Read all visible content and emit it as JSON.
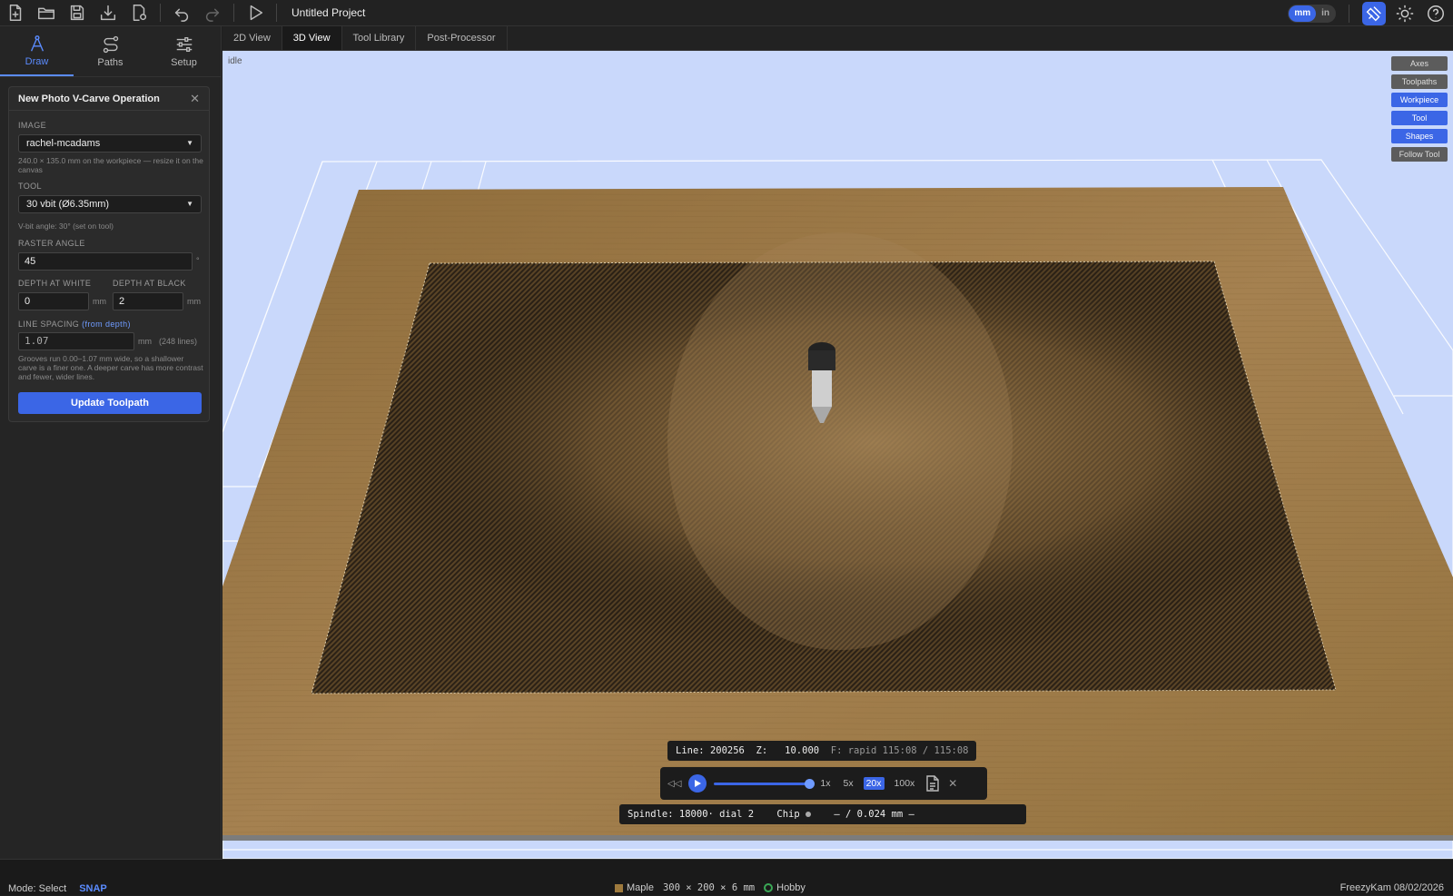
{
  "toolbar": {
    "project_title": "Untitled Project",
    "units": {
      "mm": "mm",
      "in": "in"
    }
  },
  "modes": [
    {
      "label": "Draw",
      "icon": "compass-icon"
    },
    {
      "label": "Paths",
      "icon": "path-icon"
    },
    {
      "label": "Setup",
      "icon": "sliders-icon"
    }
  ],
  "operation": {
    "title": "New Photo V-Carve Operation",
    "image_label": "IMAGE",
    "image_value": "rachel-mcadams",
    "image_hint": "240.0 × 135.0 mm on the workpiece — resize it on the canvas",
    "tool_label": "TOOL",
    "tool_value": "30 vbit (Ø6.35mm)",
    "tool_hint": "V-bit angle: 30° (set on tool)",
    "raster_label": "RASTER ANGLE",
    "raster_value": "45",
    "raster_unit": "°",
    "depth_white_label": "DEPTH AT WHITE",
    "depth_white_value": "0",
    "depth_black_label": "DEPTH AT BLACK",
    "depth_black_value": "2",
    "mm": "mm",
    "line_spacing_label": "LINE SPACING",
    "line_spacing_link": "(from depth)",
    "line_spacing_value": "1.07",
    "line_spacing_unit": "mm",
    "line_count": "(248 lines)",
    "spacing_hint": "Grooves run 0.00–1.07 mm wide, so a shallower carve is a finer one. A deeper carve has more contrast and fewer, wider lines.",
    "update_button": "Update Toolpath"
  },
  "view_tabs": [
    "2D View",
    "3D View",
    "Tool Library",
    "Post-Processor"
  ],
  "viewport": {
    "status": "idle",
    "overlay": [
      {
        "label": "Axes",
        "on": false
      },
      {
        "label": "Toolpaths",
        "on": false
      },
      {
        "label": "Workpiece",
        "on": true
      },
      {
        "label": "Tool",
        "on": true
      },
      {
        "label": "Shapes",
        "on": true
      },
      {
        "label": "Follow Tool",
        "on": false
      }
    ],
    "hud": {
      "line_label": "Line:",
      "line_value": "200256",
      "z_label": "Z:",
      "z_value": "10.000",
      "feed": "F: rapid",
      "time": "115:08 / 115:08",
      "speeds": [
        "1x",
        "5x",
        "20x",
        "100x"
      ],
      "active_speed": "20x",
      "progress": 1.0,
      "spindle_label": "Spindle:",
      "spindle_value": "18000",
      "dial": "· dial 2",
      "chip_label": "Chip",
      "chip_value": "— / 0.024 mm —"
    },
    "colors": {
      "sky": "#c9d8fb",
      "wood": "#a07d46",
      "accent": "#3b66e6"
    }
  },
  "statusbar": {
    "mode": "Mode: Select",
    "snap": "SNAP",
    "material": "Maple",
    "dimensions": "300 × 200 × 6 mm",
    "machine": "Hobby",
    "brand": "FreezyKam 08/02/2026"
  }
}
